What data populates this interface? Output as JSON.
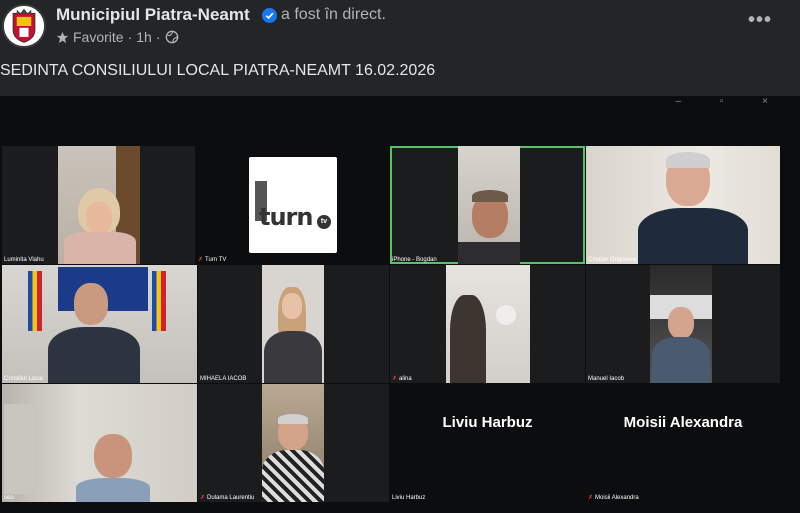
{
  "post": {
    "page_name": "Municipiul Piatra-Neamt",
    "live_status": "a fost în direct.",
    "favorites_label": "Favorite",
    "separator": "·",
    "time_ago": "1h",
    "separator2": "·",
    "more_label": "•••",
    "caption": "SEDINTA CONSILIULUI LOCAL PIATRA-NEAMT 16.02.2026"
  },
  "video": {
    "window_controls": "– ▫ ×",
    "tiles": [
      {
        "name": "Luminita Vlahu"
      },
      {
        "name": "Turn TV",
        "muted": true
      },
      {
        "name": "iPhone - Bogdan"
      },
      {
        "name": "Cristian Grigoreva"
      },
      {
        "name": "Consiliul Local"
      },
      {
        "name": "MIHAELA IACOB"
      },
      {
        "name": "alina",
        "muted": true
      },
      {
        "name": "Manuel Iacob"
      },
      {
        "name": "seo"
      },
      {
        "name": "Dulama Laurentiu",
        "muted": true
      },
      {
        "name": "Liviu Harbuz",
        "display": "Liviu Harbuz"
      },
      {
        "name": "Moisii Alexandra",
        "display": "Moisii Alexandra",
        "muted": true
      }
    ],
    "logo_text": "turn",
    "logo_tv": "tv",
    "active_speaker": "iPhone - Bogdan",
    "active_color": "#57c26b"
  },
  "colors": {
    "background": "#242526",
    "text_primary": "#e4e6eb",
    "text_secondary": "#b0b3b8",
    "verified": "#1877f2"
  }
}
